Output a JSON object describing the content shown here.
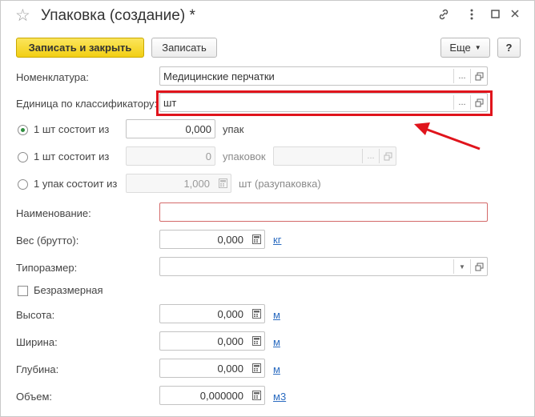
{
  "window": {
    "title": "Упаковка (создание) *"
  },
  "toolbar": {
    "save_close": "Записать и закрыть",
    "save": "Записать",
    "more": "Еще",
    "help": "?"
  },
  "form": {
    "nomenclature": {
      "label": "Номенклатура:",
      "value": "Медицинские перчатки"
    },
    "unit": {
      "label": "Единица по классификатору:",
      "value": "шт"
    },
    "option1": {
      "label": "1 шт состоит из",
      "value": "0,000",
      "unit": "упак",
      "selected": true
    },
    "option2": {
      "label": "1 шт состоит из",
      "value": "0",
      "unit": "упаковок"
    },
    "option3": {
      "label": "1 упак состоит из",
      "value": "1,000",
      "unit": "шт (разупаковка)"
    },
    "name": {
      "label": "Наименование:",
      "value": ""
    },
    "weight": {
      "label": "Вес (брутто):",
      "value": "0,000",
      "unit": "кг"
    },
    "size_type": {
      "label": "Типоразмер:",
      "value": ""
    },
    "dimensionless": {
      "label": "Безразмерная",
      "checked": false
    },
    "height": {
      "label": "Высота:",
      "value": "0,000",
      "unit": "м"
    },
    "width": {
      "label": "Ширина:",
      "value": "0,000",
      "unit": "м"
    },
    "depth": {
      "label": "Глубина:",
      "value": "0,000",
      "unit": "м"
    },
    "volume": {
      "label": "Объем:",
      "value": "0,000000",
      "unit": "м3"
    }
  },
  "colors": {
    "highlight": "#e0141c",
    "accent": "#f2cf14",
    "link": "#2a6bc0"
  },
  "icons": [
    "star-icon",
    "link-icon",
    "more-vertical-icon",
    "maximize-icon",
    "close-icon",
    "open-icon",
    "calculator-icon",
    "arrow-annotation"
  ]
}
